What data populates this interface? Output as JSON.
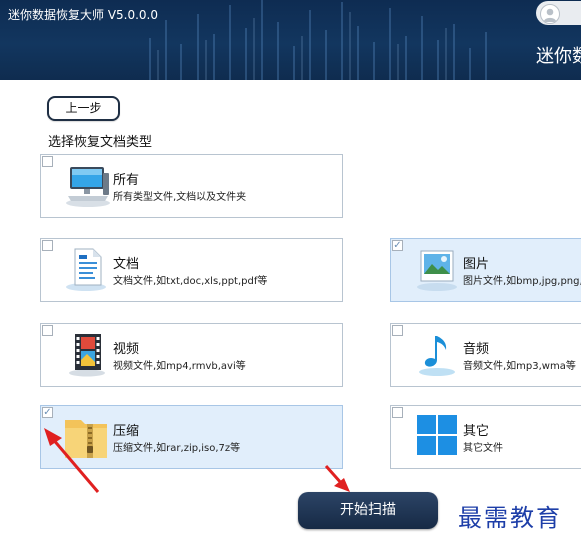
{
  "header": {
    "app_title": "迷你数据恢复大师 V5.0.0.0",
    "brand_text": "迷你数"
  },
  "nav": {
    "back_label": "上一步"
  },
  "section": {
    "label": "选择恢复文档类型"
  },
  "categories": [
    {
      "name": "所有",
      "desc": "所有类型文件,文档以及文件夹",
      "checked": false,
      "icon": "computer-icon"
    },
    {
      "name": "文档",
      "desc": "文档文件,如txt,doc,xls,ppt,pdf等",
      "checked": false,
      "icon": "document-icon"
    },
    {
      "name": "图片",
      "desc": "图片文件,如bmp,jpg,png,",
      "checked": true,
      "icon": "picture-icon"
    },
    {
      "name": "视频",
      "desc": "视频文件,如mp4,rmvb,avi等",
      "checked": false,
      "icon": "film-icon"
    },
    {
      "name": "音频",
      "desc": "音频文件,如mp3,wma等",
      "checked": false,
      "icon": "music-note-icon"
    },
    {
      "name": "压缩",
      "desc": "压缩文件,如rar,zip,iso,7z等",
      "checked": true,
      "icon": "zip-folder-icon"
    },
    {
      "name": "其它",
      "desc": "其它文件",
      "checked": false,
      "icon": "windows-grid-icon"
    }
  ],
  "actions": {
    "scan_label": "开始扫描"
  },
  "watermark": "最需教育",
  "colors": {
    "header_bg": "#12365f",
    "accent": "#1d3ea8",
    "arrow_red": "#e02020"
  }
}
